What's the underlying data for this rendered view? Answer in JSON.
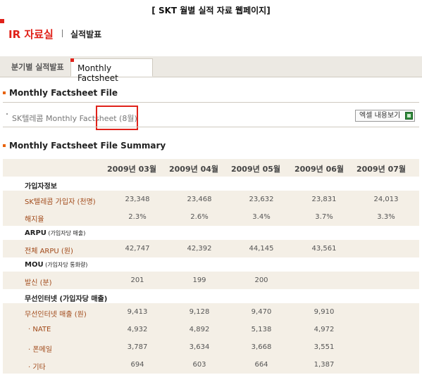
{
  "caption": "[ SKT 월별 실적 자료 웹페이지]",
  "header": {
    "title": "IR 자료실",
    "subtitle": "실적발표"
  },
  "tabs": [
    {
      "label": "분기별 실적발표",
      "active": false
    },
    {
      "label": "Monthly Factsheet",
      "active": true
    }
  ],
  "file_section": {
    "heading": "Monthly Factsheet File",
    "file_name": "SK텔레콤 Monthly Factsheet (8월)",
    "excel_button": "엑셀 내용보기"
  },
  "summary": {
    "heading": "Monthly Factsheet File Summary",
    "columns": [
      "2009년 03월",
      "2009년 04월",
      "2009년 05월",
      "2009년 06월",
      "2009년 07월"
    ],
    "rows": [
      {
        "type": "category",
        "label": "가입자정보"
      },
      {
        "type": "data",
        "label": "SK텔레콤 가입자 (천명)",
        "values": [
          "23,348",
          "23,468",
          "23,632",
          "23,831",
          "24,013"
        ]
      },
      {
        "type": "data",
        "label": "해지율",
        "values": [
          "2.3%",
          "2.6%",
          "3.4%",
          "3.7%",
          "3.3%"
        ]
      },
      {
        "type": "category",
        "label": "ARPU",
        "note": "(가입자당 매출)"
      },
      {
        "type": "data",
        "label": "전체 ARPU (원)",
        "values": [
          "42,747",
          "42,392",
          "44,145",
          "43,561",
          ""
        ]
      },
      {
        "type": "category",
        "label": "MOU",
        "note": "(가입자당 통화량)"
      },
      {
        "type": "data",
        "label": "발신 (분)",
        "values": [
          "201",
          "199",
          "200",
          "",
          ""
        ]
      },
      {
        "type": "category",
        "label": "무선인터넷 (가입자당 매출)"
      },
      {
        "type": "data",
        "label": "무선인터넷 매출 (원)",
        "values": [
          "9,413",
          "9,128",
          "9,470",
          "9,910",
          ""
        ]
      },
      {
        "type": "data",
        "label": "· NATE",
        "sub": true,
        "values": [
          "4,932",
          "4,892",
          "5,138",
          "4,972",
          ""
        ]
      },
      {
        "type": "data",
        "label": "· 폰메일",
        "sub": true,
        "values": [
          "3,787",
          "3,634",
          "3,668",
          "3,551",
          ""
        ]
      },
      {
        "type": "data",
        "label": "· 기타",
        "sub": true,
        "values": [
          "694",
          "603",
          "664",
          "1,387",
          ""
        ]
      }
    ]
  }
}
